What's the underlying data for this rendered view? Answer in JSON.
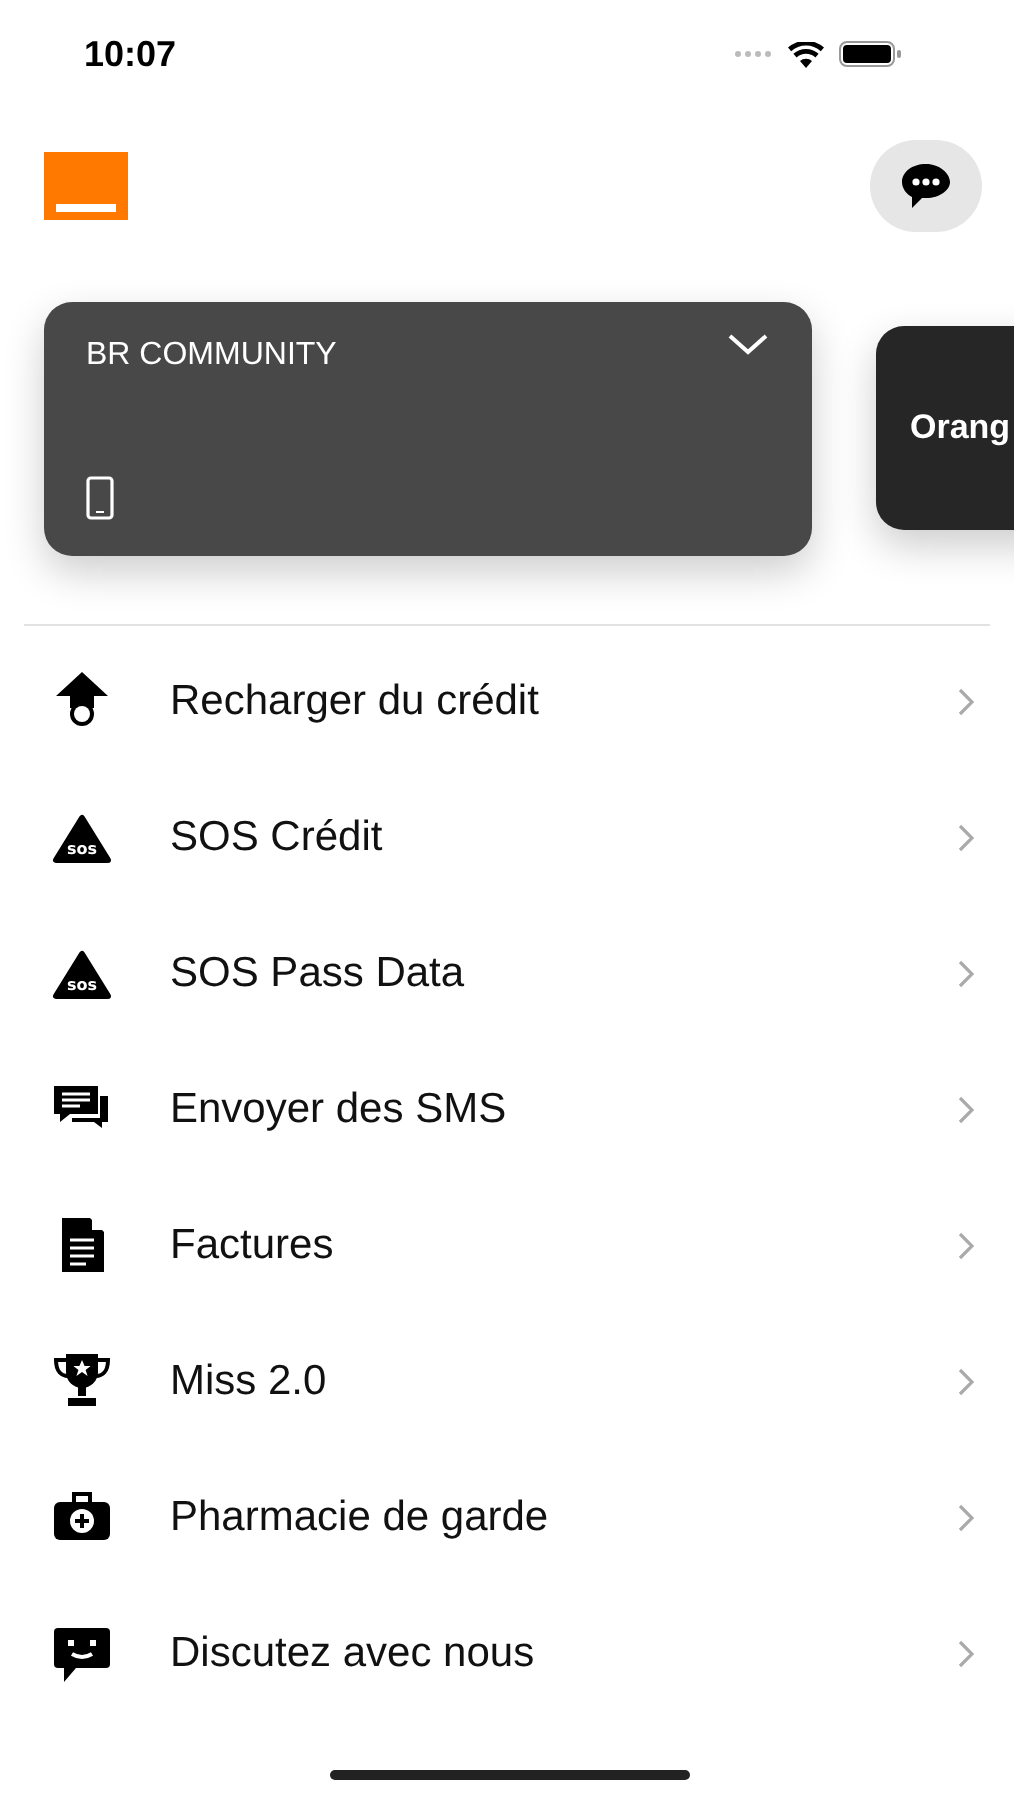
{
  "status_bar": {
    "time": "10:07"
  },
  "accounts": [
    {
      "name": "BR COMMUNITY",
      "selected": true,
      "expanded": false
    },
    {
      "name": "Orang",
      "selected": false
    }
  ],
  "menu": [
    {
      "label": "Recharger du crédit",
      "kind": "topup"
    },
    {
      "label": "SOS Crédit",
      "kind": "sos",
      "badge": "sos"
    },
    {
      "label": "SOS Pass Data",
      "kind": "sos",
      "badge": "sos"
    },
    {
      "label": "Envoyer des SMS",
      "kind": "sms"
    },
    {
      "label": "Factures",
      "kind": "invoice"
    },
    {
      "label": "Miss 2.0",
      "kind": "trophy"
    },
    {
      "label": "Pharmacie de garde",
      "kind": "pharmacy"
    },
    {
      "label": "Discutez avec nous",
      "kind": "chat"
    }
  ]
}
